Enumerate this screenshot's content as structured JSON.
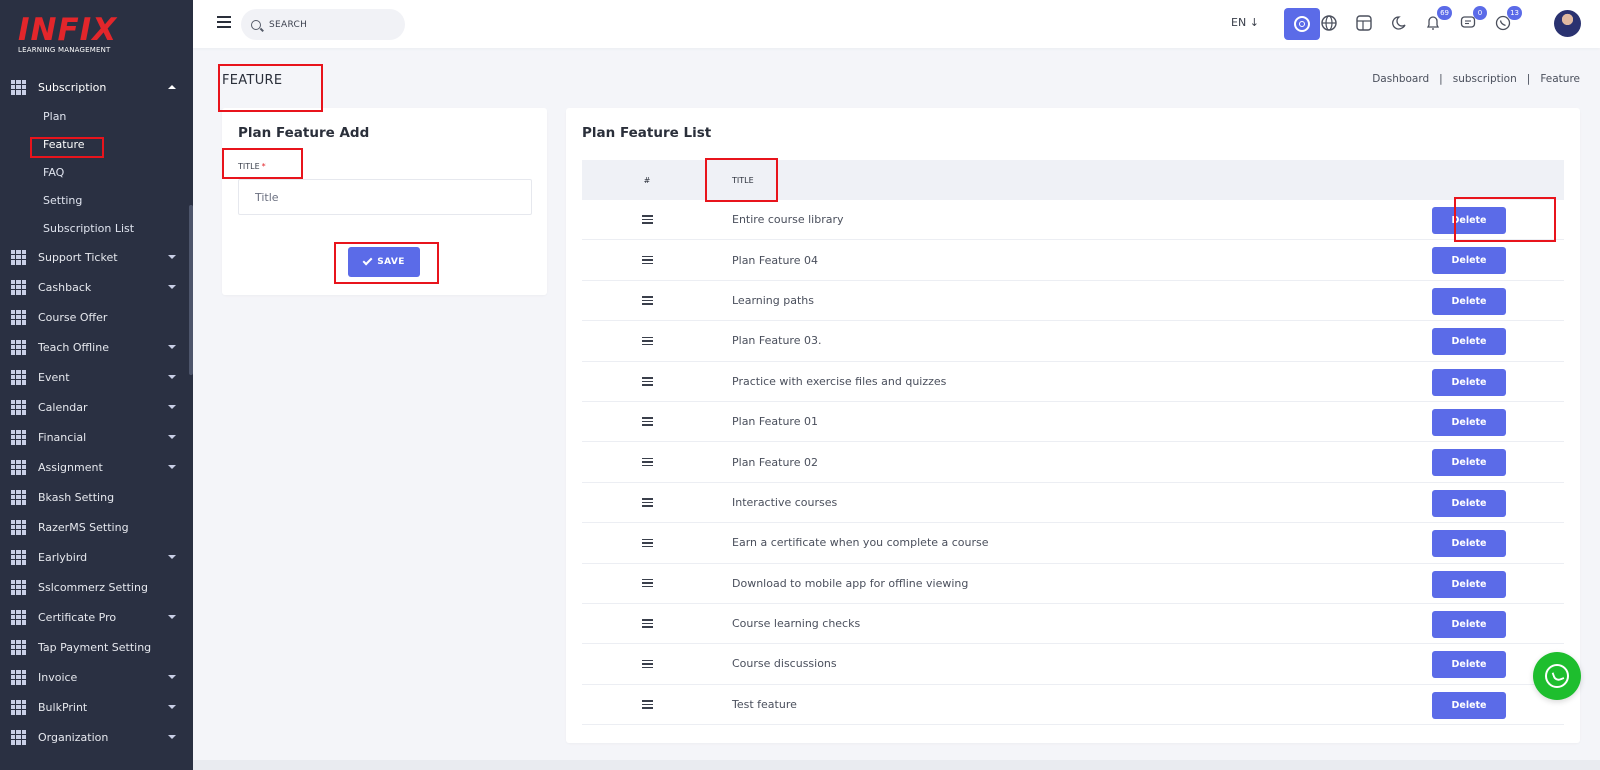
{
  "brand": {
    "name": "INFIX",
    "tagline": "LEARNING MANAGEMENT"
  },
  "header": {
    "search_placeholder": "SEARCH",
    "language": "EN",
    "notifications_count": "69",
    "messages_count": "0",
    "whatsapp_count": "13"
  },
  "sidebar": {
    "open_section": "Subscription",
    "sub_items": [
      "Plan",
      "Feature",
      "FAQ",
      "Setting",
      "Subscription List"
    ],
    "items": [
      {
        "label": "Support Ticket",
        "caret": true
      },
      {
        "label": "Cashback",
        "caret": true
      },
      {
        "label": "Course Offer",
        "caret": false
      },
      {
        "label": "Teach Offline",
        "caret": true
      },
      {
        "label": "Event",
        "caret": true
      },
      {
        "label": "Calendar",
        "caret": true
      },
      {
        "label": "Financial",
        "caret": true
      },
      {
        "label": "Assignment",
        "caret": true
      },
      {
        "label": "Bkash Setting",
        "caret": false
      },
      {
        "label": "RazerMS Setting",
        "caret": false
      },
      {
        "label": "Earlybird",
        "caret": true
      },
      {
        "label": "Sslcommerz Setting",
        "caret": false
      },
      {
        "label": "Certificate Pro",
        "caret": true
      },
      {
        "label": "Tap Payment Setting",
        "caret": false
      },
      {
        "label": "Invoice",
        "caret": true
      },
      {
        "label": "BulkPrint",
        "caret": true
      },
      {
        "label": "Organization",
        "caret": true
      }
    ]
  },
  "page": {
    "title": "FEATURE",
    "breadcrumb": [
      "Dashboard",
      "subscription",
      "Feature"
    ],
    "breadcrumb_sep": "|"
  },
  "add_form": {
    "title": "Plan Feature Add",
    "field_label": "TITLE",
    "required_mark": "*",
    "placeholder": "Title",
    "save_label": "SAVE"
  },
  "list": {
    "title": "Plan Feature List",
    "columns": [
      "#",
      "TITLE"
    ],
    "delete_label": "Delete",
    "rows": [
      "Entire course library",
      "Plan Feature 04",
      "Learning paths",
      "Plan Feature 03.",
      "Practice with exercise files and quizzes",
      "Plan Feature 01",
      "Plan Feature 02",
      "Interactive courses",
      "Earn a certificate when you complete a course",
      "Download to mobile app for offline viewing",
      "Course learning checks",
      "Course discussions",
      "Test feature"
    ]
  },
  "colors": {
    "primary": "#5b6be8",
    "sidebar": "#2a3042",
    "highlight": "#e8141c",
    "whatsapp": "#1ebe2e"
  }
}
